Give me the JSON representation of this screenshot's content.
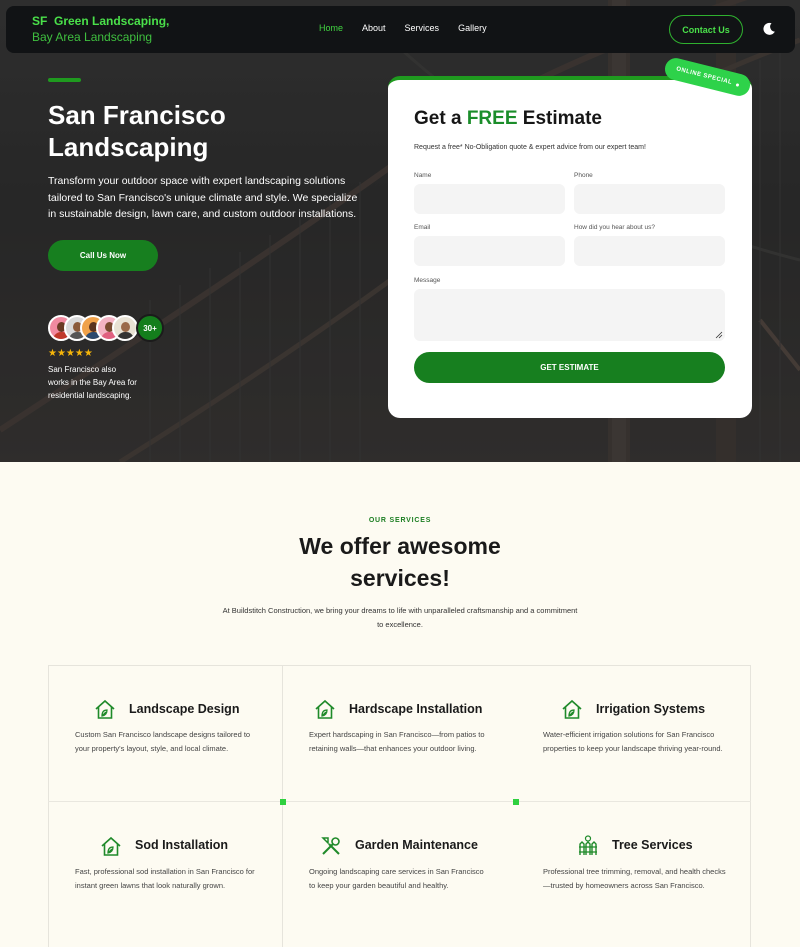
{
  "nav": {
    "brand_line1": "SF  Green Landscaping,",
    "brand_line2": "Bay Area Landscaping",
    "links": [
      "Home",
      "About",
      "Services",
      "Gallery"
    ],
    "active": "Home",
    "contact_label": "Contact Us",
    "theme_icon": "moon-icon"
  },
  "hero": {
    "title": "San Francisco Landscaping",
    "description": "Transform your outdoor space with expert landscaping solutions tailored to San Francisco's unique climate and style. We specialize in sustainable design, lawn care, and custom outdoor installations.",
    "cta_label": "Call Us Now",
    "reviewer_count": "30+",
    "rating_stars": 5,
    "stars_text": "★★★★★",
    "note": "San Francisco also works in the Bay Area for residential landscaping."
  },
  "form": {
    "ribbon": "ONLINE SPECIAL",
    "title_before": "Get a ",
    "title_highlight": "FREE",
    "title_after": " Estimate",
    "subtitle": "Request a free* No-Obligation quote & expert advice from our expert team!",
    "fields": {
      "name": "Name",
      "phone": "Phone",
      "email": "Email",
      "source": "How did you hear about us?",
      "message": "Message"
    },
    "submit_label": "GET ESTIMATE"
  },
  "services": {
    "kicker": "OUR SERVICES",
    "title": "We offer awesome services!",
    "description": "At Buildstitch Construction, we bring your dreams to life with unparalleled craftsmanship and a commitment to excellence.",
    "items": [
      {
        "name": "Landscape Design",
        "icon": "house-leaf-icon",
        "text": "Custom San Francisco landscape designs tailored to your property's layout, style, and local climate."
      },
      {
        "name": "Hardscape Installation",
        "icon": "house-leaf-icon",
        "text": "Expert hardscaping in San Francisco—from patios to retaining walls—that enhances your outdoor living."
      },
      {
        "name": "Irrigation Systems",
        "icon": "house-leaf-icon",
        "text": "Water-efficient irrigation solutions for San Francisco properties to keep your landscape thriving year-round."
      },
      {
        "name": "Sod Installation",
        "icon": "house-leaf-icon",
        "text": "Fast, professional sod installation in San Francisco for instant green lawns that look naturally grown."
      },
      {
        "name": "Garden Maintenance",
        "icon": "tools-icon",
        "text": "Ongoing landscaping care services in San Francisco to keep your garden beautiful and healthy."
      },
      {
        "name": "Tree Services",
        "icon": "fence-tree-icon",
        "text": "Professional tree trimming, removal, and health checks—trusted by homeowners across San Francisco."
      }
    ]
  },
  "colors": {
    "brand_green": "#177f1f",
    "accent_green": "#4ae04a",
    "nav_bg": "#111315",
    "section_bg": "#fdfbf2"
  }
}
